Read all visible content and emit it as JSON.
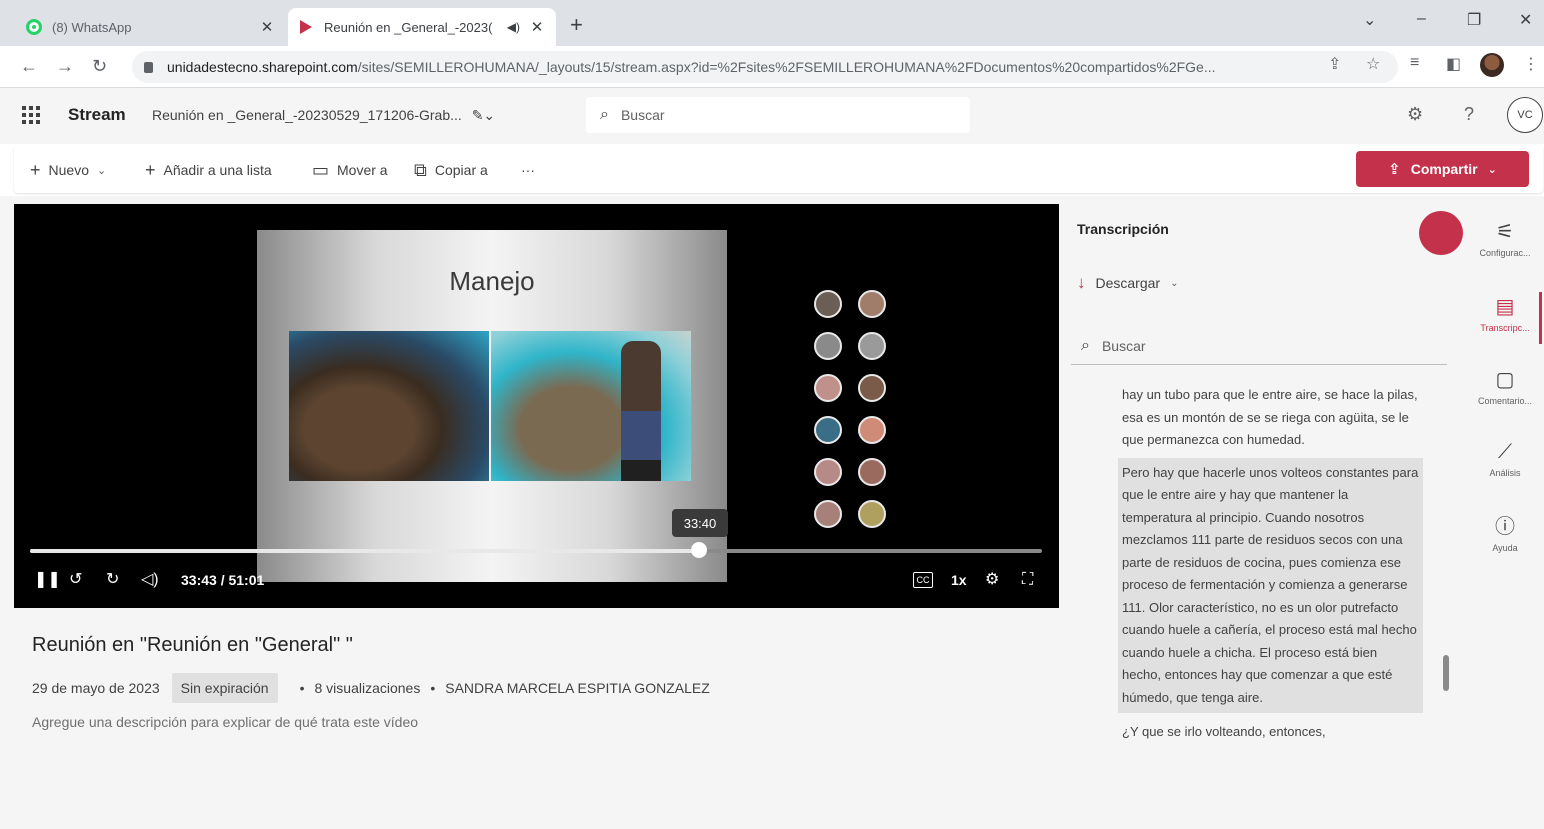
{
  "browser": {
    "tabs": [
      {
        "title": "(8) WhatsApp",
        "active": false,
        "favicon": "whatsapp-icon"
      },
      {
        "title": "Reunión en _General_-2023(",
        "active": true,
        "favicon": "stream-icon"
      }
    ],
    "url_host": "unidadestecno.sharepoint.com",
    "url_path": "/sites/SEMILLEROHUMANA/_layouts/15/stream.aspx?id=%2Fsites%2FSEMILLEROHUMANA%2FDocumentos%20compartidos%2FGe..."
  },
  "header": {
    "app_name": "Stream",
    "doc_title": "Reunión en _General_-20230529_171206-Grab...",
    "search_placeholder": "Buscar",
    "avatar_initials": "VC"
  },
  "commands": {
    "new": "Nuevo",
    "add_to_list": "Añadir a una lista",
    "move_to": "Mover a",
    "copy_to": "Copiar a",
    "more": "···",
    "share": "Compartir"
  },
  "player": {
    "slide_title": "Manejo",
    "tooltip_time": "33:40",
    "time_display": "33:43 / 51:01",
    "progress": 0.661,
    "speed": "1x",
    "cc_label": "CC"
  },
  "video": {
    "title": "Reunión en \"Reunión en \"General\" \"",
    "date": "29 de mayo de 2023",
    "expiry": "Sin expiración",
    "views": "8 visualizaciones",
    "owner": "SANDRA MARCELA ESPITIA GONZALEZ",
    "description_placeholder": "Agregue una descripción para explicar de qué trata este vídeo"
  },
  "transcript_panel": {
    "title": "Transcripción",
    "download": "Descargar",
    "search_placeholder": "Buscar",
    "prev_text": "hay un tubo para que le entre aire, se hace la pilas, esa es un montón de se se riega con agüita, se le que permanezca con humedad.",
    "active_text": "Pero hay que hacerle unos volteos constantes para que le entre aire y hay que mantener la temperatura al principio. Cuando nosotros mezclamos 111 parte de residuos secos con una parte de residuos de cocina, pues comienza ese proceso de fermentación y comienza a generarse 111. Olor característico, no es un olor putrefacto cuando huele a cañería, el proceso está mal hecho cuando huele a chicha. El proceso está bien hecho, entonces hay que comenzar a que esté húmedo, que tenga aire.",
    "next_text": "¿Y que se irlo volteando, entonces,"
  },
  "rail": [
    {
      "label": "Configurac...",
      "icon": "settings-panel-icon"
    },
    {
      "label": "Transcripc...",
      "icon": "transcript-icon",
      "active": true
    },
    {
      "label": "Comentario...",
      "icon": "comment-icon"
    },
    {
      "label": "Análisis",
      "icon": "analytics-icon"
    },
    {
      "label": "Ayuda",
      "icon": "help-icon"
    }
  ],
  "colors": {
    "accent": "#c4314b",
    "player_bg": "#000000",
    "page_bg": "#f5f5f5"
  }
}
